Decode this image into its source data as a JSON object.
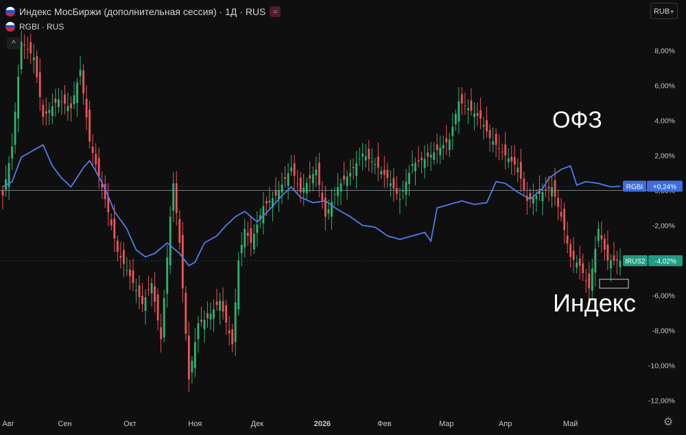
{
  "header": {
    "title": "Индекс МосБиржи (дополнительная сессия) · 1Д · RUS",
    "wave_icon": "≈",
    "second_series": "RGBI · RUS",
    "collapse_icon": "^"
  },
  "controls": {
    "currency": "RUB",
    "currency_chevron": "▾",
    "settings_icon": "⚙"
  },
  "colors": {
    "background": "#0f0f0f",
    "up": "#2bb673",
    "down": "#f0545a",
    "rgbi_line": "#4f7df0",
    "axis_text": "#c8c8c8",
    "zero_line": "#7a7a7a",
    "irus_label": "#1f9c82",
    "rgbi_label": "#3d6ee0"
  },
  "annotations": {
    "ofz": "ОФЗ",
    "index": "Индекс"
  },
  "chart_data": {
    "type": "line",
    "y_unit": "%",
    "ylim": [
      -12.3,
      9.3
    ],
    "yticks": [
      "8,00%",
      "6,00%",
      "4,00%",
      "2,00%",
      "0,00%",
      "-2,00%",
      "-4,00%",
      "-6,00%",
      "-8,00%",
      "-10,00%",
      "-12,00%"
    ],
    "ytick_values": [
      8,
      6,
      4,
      2,
      0,
      -2,
      -4,
      -6,
      -8,
      -10,
      -12
    ],
    "x_tick_labels": [
      "Авг",
      "Сен",
      "Окт",
      "Ноя",
      "Дек",
      "2026",
      "Фев",
      "Мар",
      "Апр",
      "Май"
    ],
    "x_tick_index": [
      0,
      20,
      41,
      62,
      82,
      103,
      123,
      143,
      162,
      183
    ],
    "n_points": 200,
    "series": [
      {
        "name": "IRUS2",
        "last_label": "IRUS2",
        "last_value_label": "-4,02%",
        "kind": "candles",
        "anchors": [
          [
            0,
            -0.3
          ],
          [
            3,
            2.5
          ],
          [
            6,
            8.5
          ],
          [
            10,
            7.6
          ],
          [
            13,
            4.2
          ],
          [
            18,
            5.2
          ],
          [
            22,
            4.7
          ],
          [
            25,
            6.9
          ],
          [
            28,
            2.8
          ],
          [
            33,
            -0.5
          ],
          [
            37,
            -3.5
          ],
          [
            41,
            -4.9
          ],
          [
            45,
            -6.5
          ],
          [
            48,
            -5.3
          ],
          [
            51,
            -8.5
          ],
          [
            54,
            -1.5
          ],
          [
            55,
            0.4
          ],
          [
            57,
            -3
          ],
          [
            60,
            -10.8
          ],
          [
            63,
            -7.6
          ],
          [
            66,
            -7.3
          ],
          [
            70,
            -6.3
          ],
          [
            74,
            -8.8
          ],
          [
            76,
            -4
          ],
          [
            78,
            -2.2
          ],
          [
            80,
            -3
          ],
          [
            84,
            -0.9
          ],
          [
            88,
            -0.3
          ],
          [
            93,
            1.3
          ],
          [
            96,
            -0.1
          ],
          [
            101,
            1.2
          ],
          [
            104,
            -1.5
          ],
          [
            108,
            0.2
          ],
          [
            112,
            1.0
          ],
          [
            116,
            2.1
          ],
          [
            120,
            1.5
          ],
          [
            124,
            0.7
          ],
          [
            128,
            -0.5
          ],
          [
            132,
            1.5
          ],
          [
            136,
            1.8
          ],
          [
            140,
            2.3
          ],
          [
            144,
            2.9
          ],
          [
            147,
            5.1
          ],
          [
            150,
            4.7
          ],
          [
            154,
            4.1
          ],
          [
            157,
            3.0
          ],
          [
            162,
            2.0
          ],
          [
            166,
            1.3
          ],
          [
            169,
            -0.6
          ],
          [
            173,
            -0.2
          ],
          [
            177,
            0.2
          ],
          [
            180,
            -1.5
          ],
          [
            183,
            -3.8
          ],
          [
            186,
            -4.3
          ],
          [
            189,
            -5.6
          ],
          [
            192,
            -2.2
          ],
          [
            195,
            -4.0
          ],
          [
            199,
            -4.02
          ]
        ]
      },
      {
        "name": "RGBI",
        "last_label": "RGBI",
        "last_value_label": "+0,24%",
        "kind": "line",
        "anchors": [
          [
            0,
            0.2
          ],
          [
            3,
            0.5
          ],
          [
            6,
            1.9
          ],
          [
            10,
            2.3
          ],
          [
            13,
            2.6
          ],
          [
            16,
            1.4
          ],
          [
            19,
            0.7
          ],
          [
            22,
            0.2
          ],
          [
            26,
            1.3
          ],
          [
            28,
            1.7
          ],
          [
            30,
            1.1
          ],
          [
            33,
            0.1
          ],
          [
            36,
            -1.2
          ],
          [
            40,
            -2.2
          ],
          [
            43,
            -3.4
          ],
          [
            46,
            -3.8
          ],
          [
            49,
            -3.6
          ],
          [
            53,
            -3.0
          ],
          [
            57,
            -3.6
          ],
          [
            60,
            -4.3
          ],
          [
            62,
            -4.1
          ],
          [
            65,
            -3.0
          ],
          [
            69,
            -2.6
          ],
          [
            72,
            -2.0
          ],
          [
            75,
            -1.5
          ],
          [
            78,
            -1.2
          ],
          [
            82,
            -1.8
          ],
          [
            86,
            -1.1
          ],
          [
            90,
            -0.3
          ],
          [
            93,
            0.2
          ],
          [
            96,
            -0.4
          ],
          [
            100,
            -0.7
          ],
          [
            104,
            -0.6
          ],
          [
            108,
            -1.1
          ],
          [
            112,
            -1.5
          ],
          [
            116,
            -2.0
          ],
          [
            120,
            -2.1
          ],
          [
            124,
            -2.6
          ],
          [
            128,
            -2.8
          ],
          [
            132,
            -2.6
          ],
          [
            136,
            -2.4
          ],
          [
            138,
            -2.9
          ],
          [
            140,
            -1.0
          ],
          [
            144,
            -0.8
          ],
          [
            148,
            -0.6
          ],
          [
            152,
            -0.8
          ],
          [
            156,
            -0.7
          ],
          [
            159,
            0.5
          ],
          [
            162,
            0.4
          ],
          [
            166,
            -0.1
          ],
          [
            170,
            -0.5
          ],
          [
            174,
            0.1
          ],
          [
            176,
            0.7
          ],
          [
            180,
            1.2
          ],
          [
            183,
            1.4
          ],
          [
            185,
            0.3
          ],
          [
            188,
            0.5
          ],
          [
            192,
            0.4
          ],
          [
            196,
            0.2
          ],
          [
            199,
            0.24
          ]
        ]
      }
    ]
  }
}
